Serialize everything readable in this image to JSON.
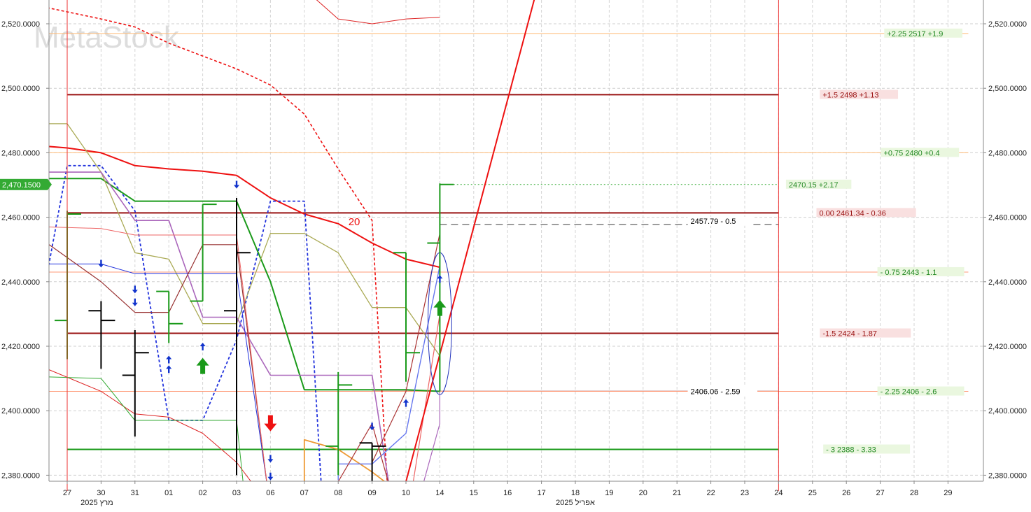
{
  "chart_data": {
    "type": "line",
    "watermark": "MetaStock",
    "ylim": [
      2377,
      2528
    ],
    "y_ticks": [
      {
        "v": 2520,
        "label": "2,520.0000"
      },
      {
        "v": 2500,
        "label": "2,500.0000"
      },
      {
        "v": 2480,
        "label": "2,480.0000"
      },
      {
        "v": 2460,
        "label": "2,460.0000"
      },
      {
        "v": 2440,
        "label": "2,440.0000"
      },
      {
        "v": 2420,
        "label": "2,420.0000"
      },
      {
        "v": 2400,
        "label": "2,400.0000"
      },
      {
        "v": 2380,
        "label": "2,380.0000"
      }
    ],
    "current_price": {
      "value": 2470.15,
      "label": "2,470.1500"
    },
    "x_ticks": [
      "27",
      "30",
      "31",
      "01",
      "02",
      "03",
      "06",
      "07",
      "08",
      "09",
      "10",
      "14",
      "15",
      "16",
      "17",
      "18",
      "19",
      "20",
      "21",
      "22",
      "23",
      "24",
      "25",
      "26",
      "27",
      "28",
      "29"
    ],
    "month_labels": [
      {
        "at": 1,
        "text": "2025 מרץ"
      },
      {
        "at": 15,
        "text": "2025 אפריל"
      }
    ],
    "vertical_markers": [
      0,
      21
    ],
    "bars": [
      {
        "x": 0,
        "o": 2428,
        "h": 2462,
        "l": 2416,
        "c": 2461,
        "color": "#1a9a1a"
      },
      {
        "x": 1,
        "o": 2431,
        "h": 2434,
        "l": 2413,
        "c": 2428,
        "color": "#000000"
      },
      {
        "x": 2,
        "o": 2411,
        "h": 2425,
        "l": 2392,
        "c": 2418,
        "color": "#000000"
      },
      {
        "x": 3,
        "o": 2437,
        "h": 2437,
        "l": 2421,
        "c": 2427,
        "color": "#1a9a1a"
      },
      {
        "x": 4,
        "o": 2434,
        "h": 2464,
        "l": 2434,
        "c": 2464,
        "color": "#1a9a1a"
      },
      {
        "x": 5,
        "o": 2431,
        "h": 2466,
        "l": 2380,
        "c": 2449,
        "color": "#000000"
      },
      {
        "x": 8,
        "o": 2389,
        "h": 2412,
        "l": 2380,
        "c": 2408,
        "color": "#1a9a1a"
      },
      {
        "x": 9,
        "o": 2390,
        "h": 2390,
        "l": 2377,
        "c": 2389,
        "color": "#000000"
      },
      {
        "x": 10,
        "o": 2449,
        "h": 2449,
        "l": 2409,
        "c": 2418,
        "color": "#1a9a1a"
      },
      {
        "x": 11,
        "o": 2452,
        "h": 2470.5,
        "l": 2406,
        "c": 2470.15,
        "color": "#1a9a1a"
      }
    ],
    "series": [
      {
        "color": "#ee1111",
        "width": 2,
        "dash": "",
        "points": [
          [
            -0.6,
            2482
          ],
          [
            0,
            2481.5
          ],
          [
            1,
            2480
          ],
          [
            2,
            2476
          ],
          [
            3,
            2475
          ],
          [
            4,
            2474.3
          ],
          [
            5,
            2473
          ],
          [
            6,
            2466
          ],
          [
            7,
            2461
          ],
          [
            8,
            2458
          ],
          [
            9,
            2452
          ],
          [
            10,
            2447
          ],
          [
            11,
            2444.5
          ]
        ]
      },
      {
        "color": "#ee1111",
        "width": 1.6,
        "dash": "4,3",
        "points": [
          [
            -0.6,
            2525
          ],
          [
            1,
            2521.5
          ],
          [
            2,
            2519
          ],
          [
            3,
            2514
          ],
          [
            4,
            2510
          ],
          [
            5,
            2506
          ],
          [
            6,
            2501
          ],
          [
            7,
            2492
          ],
          [
            8,
            2475
          ],
          [
            9,
            2459
          ],
          [
            9.45,
            2377
          ]
        ]
      },
      {
        "color": "#dd2222",
        "width": 1,
        "dash": "",
        "points": [
          [
            7.3,
            2528
          ],
          [
            8,
            2521.5
          ],
          [
            9,
            2520
          ],
          [
            10,
            2521.5
          ],
          [
            11,
            2522
          ]
        ]
      },
      {
        "color": "#2233dd",
        "width": 1.8,
        "dash": "4,3",
        "points": [
          [
            -0.6,
            2442
          ],
          [
            0,
            2476
          ],
          [
            1,
            2476
          ],
          [
            2,
            2462
          ],
          [
            3,
            2397
          ],
          [
            4,
            2397
          ],
          [
            5,
            2422
          ],
          [
            6,
            2465
          ],
          [
            7,
            2465
          ],
          [
            7.5,
            2377
          ]
        ]
      },
      {
        "color": "#1a9a1a",
        "width": 2,
        "dash": "",
        "points": [
          [
            -0.6,
            2472
          ],
          [
            1,
            2472
          ],
          [
            2,
            2465
          ],
          [
            3,
            2465
          ],
          [
            4,
            2465
          ],
          [
            5,
            2465
          ],
          [
            6,
            2440
          ],
          [
            7,
            2406.5
          ],
          [
            8,
            2406.5
          ],
          [
            9,
            2406.5
          ],
          [
            10,
            2406.5
          ],
          [
            11,
            2406
          ]
        ]
      },
      {
        "color": "#aaaa55",
        "width": 1.3,
        "dash": "",
        "points": [
          [
            -0.6,
            2489
          ],
          [
            0,
            2489
          ],
          [
            1,
            2474
          ],
          [
            2,
            2449
          ],
          [
            3,
            2447
          ],
          [
            4,
            2427
          ],
          [
            5,
            2427
          ],
          [
            6,
            2455
          ],
          [
            7,
            2455
          ],
          [
            8,
            2449
          ],
          [
            9,
            2432
          ],
          [
            10,
            2432
          ],
          [
            11,
            2417
          ]
        ]
      },
      {
        "color": "#aa66bb",
        "width": 1.6,
        "dash": "",
        "points": [
          [
            -0.6,
            2474
          ],
          [
            1,
            2474
          ],
          [
            2,
            2459
          ],
          [
            3,
            2459
          ],
          [
            4,
            2429
          ],
          [
            5,
            2429
          ],
          [
            6,
            2411
          ],
          [
            7,
            2411
          ],
          [
            8,
            2411
          ],
          [
            9,
            2411
          ],
          [
            9.5,
            2377
          ]
        ]
      },
      {
        "color": "#2233dd",
        "width": 1,
        "dash": "",
        "points": [
          [
            -0.6,
            2445.5
          ],
          [
            1,
            2445.5
          ],
          [
            2,
            2442.5
          ],
          [
            3,
            2442.5
          ],
          [
            4,
            2442.5
          ],
          [
            5,
            2442.5
          ],
          [
            5.9,
            2377
          ]
        ]
      },
      {
        "color": "#993333",
        "width": 1.2,
        "dash": "",
        "points": [
          [
            -0.6,
            2452
          ],
          [
            1,
            2440
          ],
          [
            2,
            2430.5
          ],
          [
            3,
            2430.5
          ],
          [
            4,
            2451.5
          ],
          [
            5,
            2451.5
          ],
          [
            5.9,
            2377
          ]
        ]
      },
      {
        "color": "#ee6666",
        "width": 1,
        "dash": "",
        "points": [
          [
            -0.6,
            2457
          ],
          [
            1,
            2456.5
          ],
          [
            2,
            2454.5
          ],
          [
            3,
            2454.5
          ],
          [
            4,
            2454.5
          ],
          [
            5,
            2454.5
          ],
          [
            5.9,
            2377
          ]
        ]
      },
      {
        "color": "#dd2222",
        "width": 1,
        "dash": "",
        "points": [
          [
            -0.6,
            2413
          ],
          [
            1,
            2406
          ],
          [
            2,
            2399
          ],
          [
            3,
            2398
          ],
          [
            4,
            2393
          ],
          [
            5,
            2384
          ],
          [
            5.5,
            2377
          ]
        ]
      },
      {
        "color": "#33aa33",
        "width": 1,
        "dash": "",
        "points": [
          [
            -0.6,
            2410.5
          ],
          [
            1,
            2410
          ],
          [
            2,
            2397
          ],
          [
            3,
            2397
          ],
          [
            4,
            2397
          ],
          [
            5,
            2397
          ],
          [
            5.2,
            2377
          ]
        ]
      },
      {
        "color": "#ee9933",
        "width": 1.8,
        "dash": "",
        "points": [
          [
            7,
            2377
          ],
          [
            7,
            2391
          ],
          [
            8,
            2388
          ],
          [
            9,
            2381
          ],
          [
            9.5,
            2377
          ]
        ]
      },
      {
        "color": "#6677ee",
        "width": 1.4,
        "dash": "",
        "points": [
          [
            8,
            2378.5
          ],
          [
            8,
            2383.5
          ],
          [
            9,
            2383.5
          ],
          [
            10,
            2393
          ],
          [
            11,
            2445
          ]
        ]
      },
      {
        "color": "#aa3333",
        "width": 1.2,
        "dash": "",
        "points": [
          [
            8,
            2378
          ],
          [
            9,
            2396
          ],
          [
            9.5,
            2377
          ]
        ]
      },
      {
        "color": "#aa3333",
        "width": 1.2,
        "dash": "",
        "points": [
          [
            9,
            2384
          ],
          [
            10,
            2406
          ],
          [
            11,
            2455
          ]
        ]
      },
      {
        "color": "#aa66bb",
        "width": 1.2,
        "dash": "",
        "points": [
          [
            10.5,
            2377
          ],
          [
            11,
            2396
          ],
          [
            11,
            2445
          ]
        ]
      },
      {
        "color": "#ee6666",
        "width": 1.2,
        "dash": "",
        "points": [
          [
            10.2,
            2377
          ],
          [
            11,
            2430
          ]
        ]
      },
      {
        "color": "#ee1111",
        "width": 2,
        "dash": "",
        "points": [
          [
            10,
            2378
          ],
          [
            13.8,
            2528
          ]
        ]
      }
    ],
    "levels": [
      {
        "value": 2517,
        "color": "#ffbb77",
        "width": 1,
        "dash": "",
        "x0": -0.6,
        "x1": 26.6,
        "label": "+2.25  2517  +1.9",
        "label_color": "#228822",
        "label_bg": "#eaf7df",
        "label_x": 24.2
      },
      {
        "value": 2498,
        "color": "#991111",
        "width": 2,
        "dash": "",
        "x0": 0,
        "x1": 21,
        "label": "+1.5  2498  +1.13",
        "label_color": "#991111",
        "label_bg": "#f9e0e0",
        "label_x": 22.3
      },
      {
        "value": 2480,
        "color": "#ffbb77",
        "width": 1,
        "dash": "",
        "x0": -0.6,
        "x1": 26.6,
        "label": "+0.75  2480  +0.4",
        "label_color": "#228822",
        "label_bg": "#eaf7df",
        "label_x": 24.1
      },
      {
        "value": 2470.15,
        "color": "#33aa33",
        "width": 1,
        "dash": "2,3",
        "x0": 11.4,
        "x1": 21,
        "label": "2470.15  +2.17",
        "label_color": "#228822",
        "label_bg": "#eaf7df",
        "label_x": 21.3
      },
      {
        "value": 2461.34,
        "color": "#991111",
        "width": 2,
        "dash": "",
        "x0": 0,
        "x1": 21,
        "label": "0.00  2461.34   - 0.36",
        "label_color": "#991111",
        "label_bg": "#f9e0e0",
        "label_x": 22.2
      },
      {
        "value": 2457.79,
        "color": "#888888",
        "width": 1.6,
        "dash": "10,6",
        "x0": 11,
        "x1": 21,
        "label": "2457.79  - 0.5",
        "label_color": "#000000",
        "label_bg": "#ffffff",
        "label_x": 18.4
      },
      {
        "value": 2443,
        "color": "#ff9977",
        "width": 1,
        "dash": "",
        "x0": -0.6,
        "x1": 26.6,
        "label": "- 0.75  2443  - 1.1",
        "label_color": "#228822",
        "label_bg": "#eaf7df",
        "label_x": 24.0
      },
      {
        "value": 2424,
        "color": "#991111",
        "width": 2,
        "dash": "",
        "x0": 0,
        "x1": 21,
        "label": "-1.5   2424   - 1.87",
        "label_color": "#991111",
        "label_bg": "#f9e0e0",
        "label_x": 22.3
      },
      {
        "value": 2406.06,
        "color": "#993333",
        "width": 1,
        "dash": "",
        "x0": 9,
        "x1": 21,
        "label": "2406.06  - 2.59",
        "label_color": "#000000",
        "label_bg": "#ffffff",
        "label_x": 18.4
      },
      {
        "value": 2406,
        "color": "#ff9977",
        "width": 1,
        "dash": "",
        "x0": -0.6,
        "x1": 26.6,
        "label": "- 2.25  2406  - 2.6",
        "label_color": "#228822",
        "label_bg": "#eaf7df",
        "label_x": 24.0
      },
      {
        "value": 2388,
        "color": "#1a9a1a",
        "width": 2,
        "dash": "",
        "x0": 0,
        "x1": 21,
        "label": "- 3   2388   - 3.33",
        "label_color": "#228822",
        "label_bg": "#eaf7df",
        "label_x": 22.4
      }
    ],
    "annotations": [
      {
        "text": "20",
        "x": 8.3,
        "y": 2457.5,
        "color": "#ee1111"
      }
    ],
    "markers": [
      {
        "x": 1,
        "y": 2445.5,
        "kind": "small-down",
        "color": "#1133cc"
      },
      {
        "x": 2,
        "y": 2437.5,
        "kind": "small-down",
        "color": "#1133cc"
      },
      {
        "x": 2,
        "y": 2433.5,
        "kind": "small-down",
        "color": "#1133cc"
      },
      {
        "x": 3,
        "y": 2416,
        "kind": "small-up",
        "color": "#1133cc"
      },
      {
        "x": 3,
        "y": 2413,
        "kind": "small-up",
        "color": "#1133cc"
      },
      {
        "x": 4,
        "y": 2420,
        "kind": "small-up",
        "color": "#1133cc"
      },
      {
        "x": 4,
        "y": 2414,
        "kind": "big-up",
        "color": "#1a9a1a"
      },
      {
        "x": 5,
        "y": 2470,
        "kind": "small-down",
        "color": "#1133cc"
      },
      {
        "x": 6,
        "y": 2396,
        "kind": "big-down",
        "color": "#ee1111"
      },
      {
        "x": 6,
        "y": 2385,
        "kind": "small-down",
        "color": "#1133cc"
      },
      {
        "x": 6,
        "y": 2379.5,
        "kind": "small-down",
        "color": "#1133cc"
      },
      {
        "x": 9,
        "y": 2395,
        "kind": "small-down",
        "color": "#1133cc"
      },
      {
        "x": 10,
        "y": 2402.5,
        "kind": "small-up",
        "color": "#1133cc"
      },
      {
        "x": 11,
        "y": 2441,
        "kind": "small-up",
        "color": "#1133cc"
      },
      {
        "x": 11,
        "y": 2432,
        "kind": "big-up",
        "color": "#1a9a1a"
      }
    ],
    "ellipse": {
      "x": 11,
      "y": 2427,
      "rx_days": 0.35,
      "ry_value": 22,
      "color": "#2233bb"
    },
    "grid": true
  }
}
